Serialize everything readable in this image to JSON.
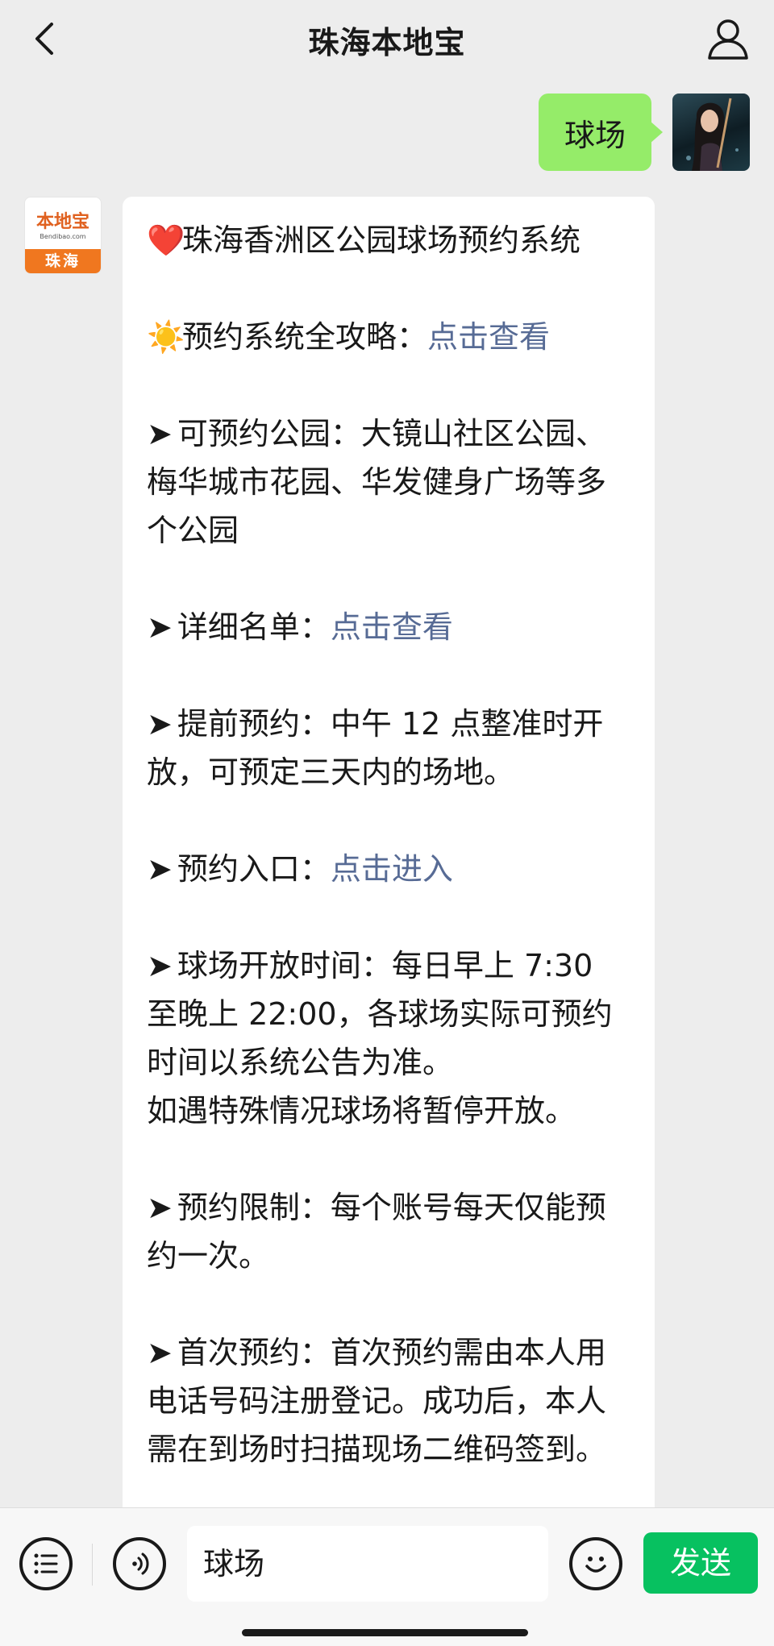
{
  "header": {
    "title": "珠海本地宝",
    "back_icon": "chevron-left-icon",
    "profile_icon": "person-icon"
  },
  "user_message": {
    "text": "球场",
    "bubble_color": "#95ec69"
  },
  "bot": {
    "avatar_logo": "本地宝",
    "avatar_domain": "Bendibao.com",
    "avatar_city": "珠海",
    "brand_color": "#f0771f"
  },
  "bot_message": {
    "title_emoji": "❤️",
    "title": "珠海香洲区公园球场预约系统",
    "guide_emoji": "☀️",
    "guide_label": "预约系统全攻略：",
    "guide_link": "点击查看",
    "arrow": "➤",
    "parks_label": "可预约公园：",
    "parks_line1": "大镜山社区公园、",
    "parks_line2": "梅华城市花园、华发健身广场等多",
    "parks_line3": "个公园",
    "list_label": "详细名单：",
    "list_link": "点击查看",
    "advance_label": "提前预约：",
    "advance_line1": "中午 12 点整准时开",
    "advance_line2": "放，可预定三天内的场地。",
    "entry_label": "预约入口：",
    "entry_link": "点击进入",
    "hours_label": "球场开放时间：",
    "hours_line1": "每日早上 7:30",
    "hours_line2": "至晚上 22:00，各球场实际可预约",
    "hours_line3": "时间以系统公告为准。",
    "hours_line4": "如遇特殊情况球场将暂停开放。",
    "limit_label": "预约限制：",
    "limit_line1": "每个账号每天仅能预",
    "limit_line2": "约一次。",
    "first_label": "首次预约：",
    "first_line1": "首次预约需由本人用",
    "first_line2": "电话号码注册登记。成功后，本人",
    "first_line3": "需在到场时扫描现场二维码签到。",
    "link_color": "#576b95"
  },
  "input_bar": {
    "menu_icon": "list-menu-icon",
    "voice_icon": "voice-icon",
    "emoji_icon": "emoji-icon",
    "input_value": "球场",
    "send_label": "发送",
    "send_color": "#07c160"
  }
}
